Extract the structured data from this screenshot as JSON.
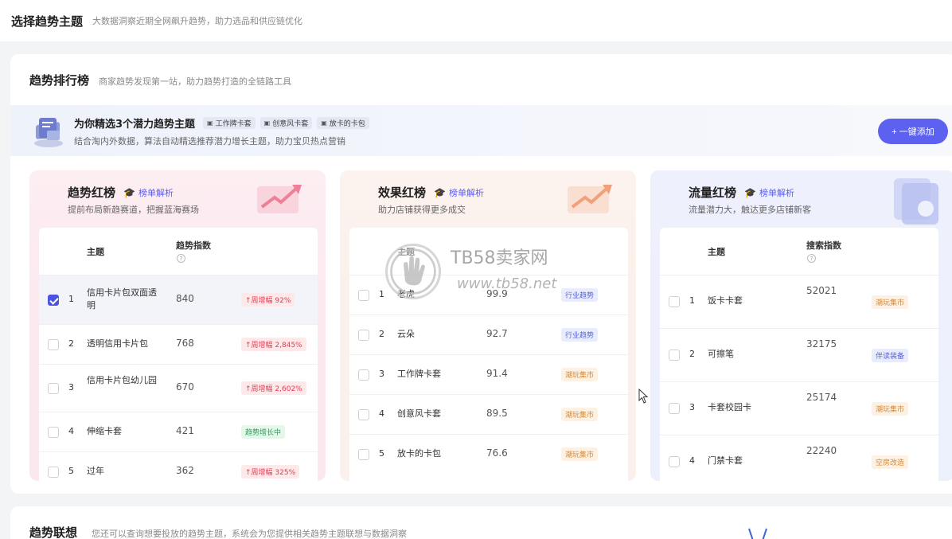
{
  "topbar": {
    "title": "选择趋势主题",
    "subtitle": "大数据洞察近期全网飙升趋势，助力选品和供应链优化"
  },
  "section": {
    "title": "趋势排行榜",
    "subtitle": "商家趋势发现第一站，助力趋势打造的全链路工具"
  },
  "recommend": {
    "title": "为你精选3个潜力趋势主题",
    "chips": [
      "工作牌卡套",
      "创意风卡套",
      "放卡的卡包"
    ],
    "desc": "结合淘内外数据，算法自动精选推荐潜力增长主题，助力宝贝热点营销",
    "add_button": "+ 一键添加"
  },
  "boards": [
    {
      "title": "趋势红榜",
      "link": "榜单解析",
      "subtitle": "提前布局新趋赛道，把握蓝海赛场",
      "col_topic": "主题",
      "col_metric": "趋势指数",
      "rows": [
        {
          "idx": "1",
          "name": "信用卡片包双面透明",
          "value": "840",
          "tag": "↑周增幅 92%",
          "checked": true
        },
        {
          "idx": "2",
          "name": "透明信用卡片包",
          "value": "768",
          "tag": "↑周增幅 2,845%"
        },
        {
          "idx": "3",
          "name": "信用卡片包幼儿园",
          "value": "670",
          "tag": "↑周增幅 2,602%"
        },
        {
          "idx": "4",
          "name": "伸缩卡套",
          "value": "421",
          "tag": "趋势增长中"
        },
        {
          "idx": "5",
          "name": "过年",
          "value": "362",
          "tag": "↑周增幅 325%"
        }
      ]
    },
    {
      "title": "效果红榜",
      "link": "榜单解析",
      "subtitle": "助力店铺获得更多成交",
      "col_topic": "主题",
      "col_metric": "",
      "rows": [
        {
          "idx": "1",
          "name": "老虎",
          "value": "99.9",
          "tag": "行业趋势"
        },
        {
          "idx": "2",
          "name": "云朵",
          "value": "92.7",
          "tag": "行业趋势"
        },
        {
          "idx": "3",
          "name": "工作牌卡套",
          "value": "91.4",
          "tag": "潮玩集市"
        },
        {
          "idx": "4",
          "name": "创意风卡套",
          "value": "89.5",
          "tag": "潮玩集市"
        },
        {
          "idx": "5",
          "name": "放卡的卡包",
          "value": "76.6",
          "tag": "潮玩集市"
        }
      ]
    },
    {
      "title": "流量红榜",
      "link": "榜单解析",
      "subtitle": "流量潜力大，触达更多店铺新客",
      "col_topic": "主题",
      "col_metric": "搜索指数",
      "rows": [
        {
          "idx": "1",
          "name": "饭卡卡套",
          "value": "52021",
          "tag": "潮玩集市"
        },
        {
          "idx": "2",
          "name": "可擦笔",
          "value": "32175",
          "tag": "伴读装备"
        },
        {
          "idx": "3",
          "name": "卡套校园卡",
          "value": "25174",
          "tag": "潮玩集市"
        },
        {
          "idx": "4",
          "name": "门禁卡套",
          "value": "22240",
          "tag": "空房改造"
        }
      ]
    }
  ],
  "bottom": {
    "title": "趋势联想",
    "subtitle": "您还可以查询想要投放的趋势主题，系统会为您提供相关趋势主题联想与数据洞察"
  },
  "watermark": {
    "line1": "TB58卖家网",
    "line2": "www.tb58.net"
  },
  "colors": {
    "accent": "#5d61f0",
    "up": "#e03e52",
    "green": "#2e9e55"
  }
}
